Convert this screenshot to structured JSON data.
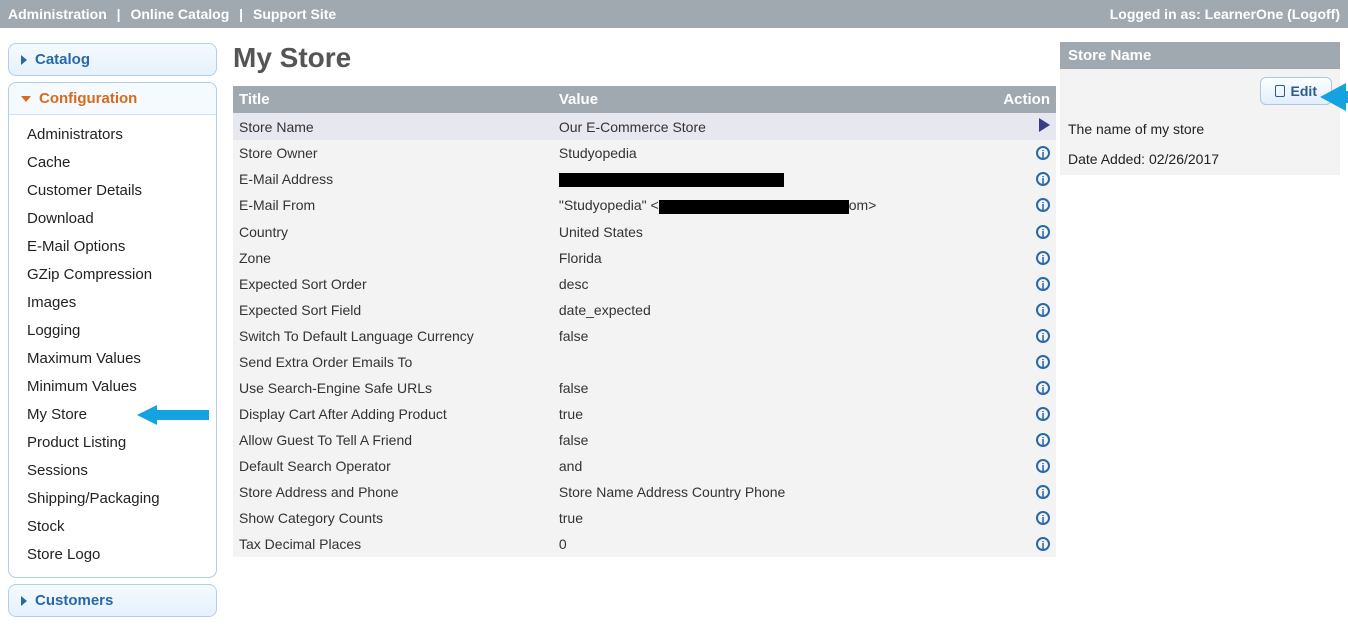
{
  "topbar": {
    "links": [
      "Administration",
      "Online Catalog",
      "Support Site"
    ],
    "logged_in_prefix": "Logged in as:",
    "user": "LearnerOne",
    "logoff": "Logoff"
  },
  "sidebar": {
    "catalog": "Catalog",
    "configuration": "Configuration",
    "config_items": [
      "Administrators",
      "Cache",
      "Customer Details",
      "Download",
      "E-Mail Options",
      "GZip Compression",
      "Images",
      "Logging",
      "Maximum Values",
      "Minimum Values",
      "My Store",
      "Product Listing",
      "Sessions",
      "Shipping/Packaging",
      "Stock",
      "Store Logo"
    ],
    "customers": "Customers"
  },
  "page": {
    "title": "My Store"
  },
  "table": {
    "headers": {
      "title": "Title",
      "value": "Value",
      "action": "Action"
    },
    "rows": [
      {
        "title": "Store Name",
        "value": "Our E-Commerce Store",
        "action": "play",
        "selected": true
      },
      {
        "title": "Store Owner",
        "value": "Studyopedia",
        "action": "info"
      },
      {
        "title": "E-Mail Address",
        "value": "██████████████████████",
        "action": "info",
        "blackout": true,
        "bw": 225
      },
      {
        "title": "E-Mail From",
        "value_prefix": "\"Studyopedia\" <",
        "value_suffix": "om>",
        "action": "info",
        "blackout_mid": true,
        "bw": 190
      },
      {
        "title": "Country",
        "value": "United States",
        "action": "info"
      },
      {
        "title": "Zone",
        "value": "Florida",
        "action": "info"
      },
      {
        "title": "Expected Sort Order",
        "value": "desc",
        "action": "info"
      },
      {
        "title": "Expected Sort Field",
        "value": "date_expected",
        "action": "info"
      },
      {
        "title": "Switch To Default Language Currency",
        "value": "false",
        "action": "info"
      },
      {
        "title": "Send Extra Order Emails To",
        "value": "",
        "action": "info"
      },
      {
        "title": "Use Search-Engine Safe URLs",
        "value": "false",
        "action": "info"
      },
      {
        "title": "Display Cart After Adding Product",
        "value": "true",
        "action": "info"
      },
      {
        "title": "Allow Guest To Tell A Friend",
        "value": "false",
        "action": "info"
      },
      {
        "title": "Default Search Operator",
        "value": "and",
        "action": "info"
      },
      {
        "title": "Store Address and Phone",
        "value": "Store Name Address Country Phone",
        "action": "info"
      },
      {
        "title": "Show Category Counts",
        "value": "true",
        "action": "info"
      },
      {
        "title": "Tax Decimal Places",
        "value": "0",
        "action": "info"
      }
    ]
  },
  "right": {
    "head": "Store Name",
    "edit": "Edit",
    "description": "The name of my store",
    "date_label": "Date Added:",
    "date_value": "02/26/2017"
  }
}
